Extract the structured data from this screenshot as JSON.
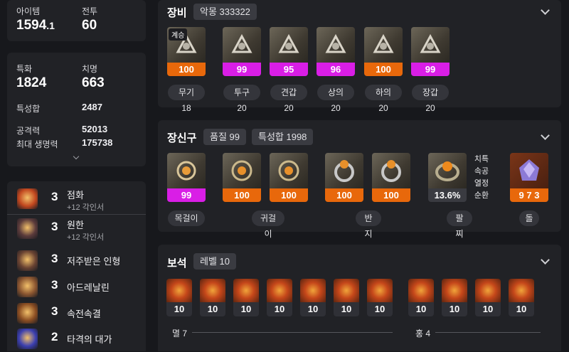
{
  "summary": {
    "item_level_label": "아이템",
    "item_level_int": "1594",
    "item_level_dec": ".1",
    "combat_label": "전투",
    "combat_value": "60"
  },
  "stats": {
    "spec_label": "특화",
    "spec_value": "1824",
    "crit_label": "치명",
    "crit_value": "663",
    "total_label": "특성합",
    "total_value": "2487",
    "atk_label": "공격력",
    "atk_value": "52013",
    "hp_label": "최대 생명력",
    "hp_value": "175738"
  },
  "engravings": [
    {
      "level": "3",
      "name": "점화",
      "sub": "+12 각인서",
      "icon": "fire-burst-icon",
      "color": "#c1471f"
    },
    {
      "level": "3",
      "name": "원한",
      "sub": "+12 각인서",
      "icon": "demon-head-icon",
      "color": "#5b3b3b"
    },
    {
      "level": "3",
      "name": "저주받은 인형",
      "icon": "cursed-doll-icon",
      "color": "#6a4332"
    },
    {
      "level": "3",
      "name": "아드레날린",
      "icon": "adrenaline-icon",
      "color": "#8a5530"
    },
    {
      "level": "3",
      "name": "속전속결",
      "icon": "haste-icon",
      "color": "#8a4d22"
    },
    {
      "level": "2",
      "name": "타격의 대가",
      "icon": "strike-master-icon",
      "color": "#3b3fb0"
    }
  ],
  "equipment": {
    "title": "장비",
    "chip": "악몽 333322",
    "items": [
      {
        "quality": "100",
        "bar": "org",
        "label": "무기 18",
        "icon": "weapon-staff-icon",
        "tag": "계승"
      },
      {
        "quality": "99",
        "bar": "mag",
        "label": "투구 20",
        "icon": "helmet-circlet-icon"
      },
      {
        "quality": "95",
        "bar": "mag",
        "label": "견갑 20",
        "icon": "shoulder-icon"
      },
      {
        "quality": "96",
        "bar": "mag",
        "label": "상의 20",
        "icon": "dress-top-icon"
      },
      {
        "quality": "100",
        "bar": "org",
        "label": "하의 20",
        "icon": "legs-bottom-icon"
      },
      {
        "quality": "99",
        "bar": "mag",
        "label": "장갑 20",
        "icon": "gloves-icon"
      }
    ]
  },
  "accessories": {
    "title": "장신구",
    "chip1": "품질 99",
    "chip2": "특성합 1998",
    "necklace": {
      "quality": "99",
      "label": "목걸이"
    },
    "earrings": [
      {
        "quality": "100"
      },
      {
        "quality": "100"
      }
    ],
    "earring_label": "귀걸이",
    "rings": [
      {
        "quality": "100"
      },
      {
        "quality": "100"
      }
    ],
    "ring_label": "반지",
    "bracelet": {
      "value": "13.6%",
      "label": "팔찌",
      "traits": [
        "치특",
        "속공",
        "열정",
        "순환"
      ]
    },
    "stone": {
      "value": "9 7 3",
      "label": "돌"
    }
  },
  "gems": {
    "title": "보석",
    "chip": "레벨 10",
    "left_levels": [
      "10",
      "10",
      "10",
      "10",
      "10",
      "10",
      "10"
    ],
    "left_label": "멸 7",
    "right_levels": [
      "10",
      "10",
      "10",
      "10"
    ],
    "right_label": "홍 4"
  }
}
